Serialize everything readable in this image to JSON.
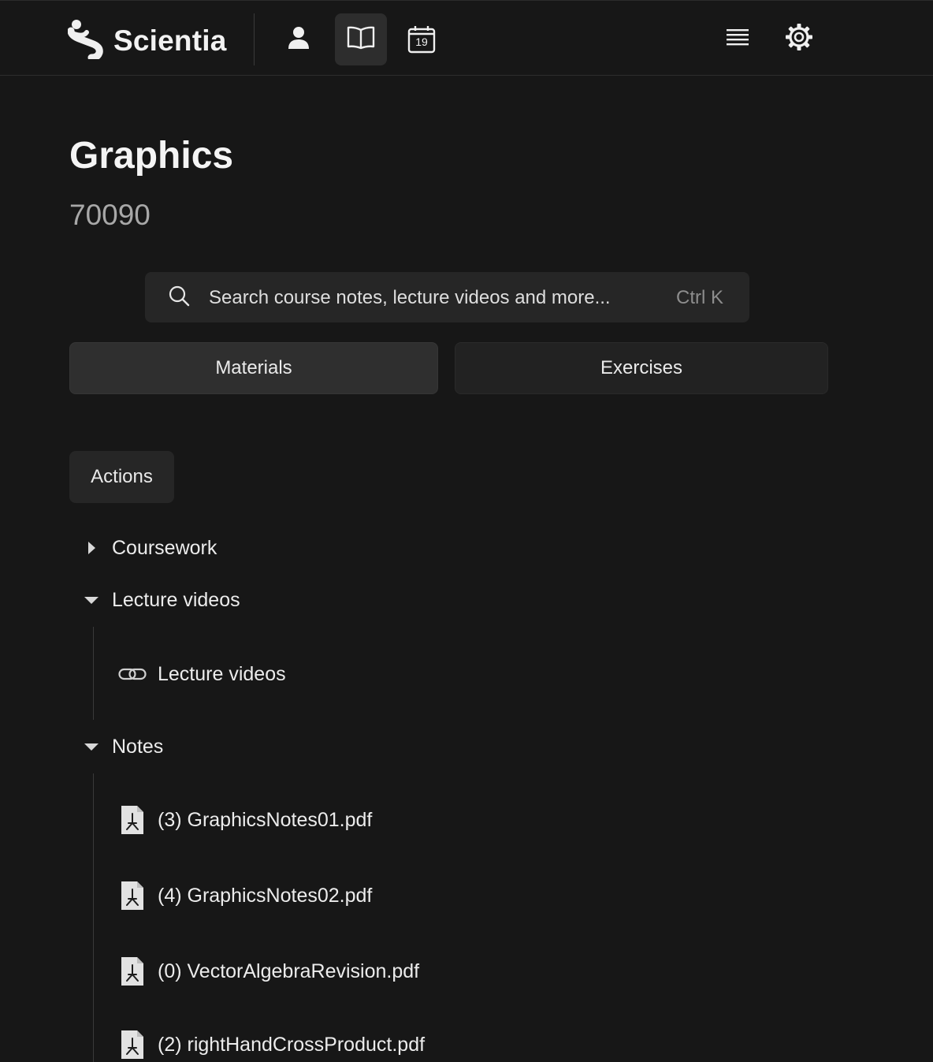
{
  "brand": {
    "name": "Scientia"
  },
  "nav": {
    "calendar_day": "19"
  },
  "course": {
    "title": "Graphics",
    "code": "70090"
  },
  "search": {
    "placeholder": "Search course notes, lecture videos and more...",
    "shortcut": "Ctrl K"
  },
  "tabs": [
    {
      "label": "Materials",
      "active": true
    },
    {
      "label": "Exercises",
      "active": false
    }
  ],
  "actions": {
    "label": "Actions"
  },
  "folders": {
    "coursework": {
      "label": "Coursework",
      "expanded": false
    },
    "lecture_videos": {
      "label": "Lecture videos",
      "expanded": true,
      "items": [
        {
          "label": "Lecture videos",
          "icon": "link-icon"
        }
      ]
    },
    "notes": {
      "label": "Notes",
      "expanded": true,
      "items": [
        {
          "label": "(3) GraphicsNotes01.pdf",
          "icon": "pdf-file-icon"
        },
        {
          "label": "(4) GraphicsNotes02.pdf",
          "icon": "pdf-file-icon"
        },
        {
          "label": "(0) VectorAlgebraRevision.pdf",
          "icon": "pdf-file-icon"
        },
        {
          "label": "(2) rightHandCrossProduct.pdf",
          "icon": "pdf-file-icon"
        }
      ]
    }
  },
  "colors": {
    "background": "#171717",
    "surface": "#262626",
    "text": "#ececec",
    "muted": "#a8a8a8"
  }
}
